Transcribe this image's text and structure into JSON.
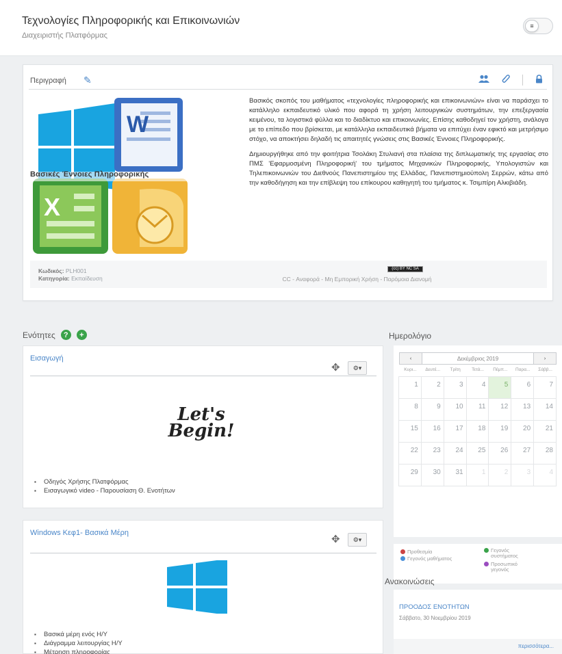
{
  "header": {
    "title": "Τεχνολογίες Πληροφορικής και Επικοινωνιών",
    "subtitle": "Διαχειριστής Πλατφόρμας"
  },
  "description": {
    "label": "Περιγραφή",
    "logo_caption": "Βασικές Έννοιες Πληροφορικής",
    "paragraphs": [
      "Βασικός σκοπός του μαθήματος «τεχνολογίες πληροφορικής και επικοινωνιών» είναι να παράσχει το κατάλληλο εκπαιδευτικό υλικό που αφορά τη χρήση λειτουργικών συστημάτων, την επεξεργασία κειμένου, τα λογιστικά φύλλα και το διαδίκτυο και επικοινωνίες. Επίσης καθοδηγεί τον χρήστη, ανάλογα με το επίπεδο που βρίσκεται, με κατάλληλα εκπαιδευτικά βήματα να επιτύχει έναν εφικτό και μετρήσιμο στόχο, να αποκτήσει δηλαδή τις απαιτητές γνώσεις στις Βασικές Έννοιες Πληροφορικής.",
      "Δημιουργήθηκε από την φοιτήτρια Τσολάκη Στυλιανή στα πλαίσια της διπλωματικής της εργασίας στο ΠΜΣ 'Εφαρμοσμένη Πληροφορική' του τμήματος Μηχανικών Πληροφορικής, Υπολογιστών και Τηλεπικοινωνιών του Διεθνούς Πανεπιστημίου της Ελλάδας, Πανεπιστημιούπολη Σερρών, κάτω από την καθοδήγηση και την επίβλεψη του επίκουρου καθηγητή του τμήματος κ. Τσιμπίρη Αλκιβιάδη."
    ],
    "code_label": "Κωδικός:",
    "code_value": "PLH001",
    "category_label": "Κατηγορία:",
    "category_value": "Εκπαίδευση",
    "license_badge": "(cc) BY NC SA",
    "license_text": "CC - Αναφορά - Μη Εμπορική Χρήση - Παρόμοια Διανομή"
  },
  "sections": {
    "title": "Ενότητες",
    "items": [
      {
        "title": "Εισαγωγή",
        "image_text_1": "Let's",
        "image_text_2": "Begin!",
        "links": [
          "Οδηγός Χρήσης Πλατφόρμας",
          "Εισαγωγικό video - Παρουσίαση Θ. Ενοτήτων"
        ]
      },
      {
        "title": "Windows Κεφ1- Βασικά Μέρη",
        "links": [
          "Βασικά μέρη ενός Η/Υ",
          "Διάγραμμα λειτουργίας Η/Υ",
          "Μέτρηση πληροφορίας"
        ]
      }
    ]
  },
  "calendar": {
    "title": "Ημερολόγιο",
    "month": "Δεκέμβριος 2019",
    "prev": "‹",
    "next": "›",
    "weekdays": [
      "Κυρι...",
      "Δευτέ...",
      "Τρίτη",
      "Τετά...",
      "Πέμπ...",
      "Παρα...",
      "Σάββ..."
    ],
    "today": 5,
    "days": [
      "1",
      "2",
      "3",
      "4",
      "5",
      "6",
      "7",
      "8",
      "9",
      "10",
      "11",
      "12",
      "13",
      "14",
      "15",
      "16",
      "17",
      "18",
      "19",
      "20",
      "21",
      "22",
      "23",
      "24",
      "25",
      "26",
      "27",
      "28",
      "29",
      "30",
      "31",
      "1",
      "2",
      "3",
      "4"
    ]
  },
  "legend": {
    "deadline": "Προθεσμία",
    "course_events": "Γεγονός μαθήματος",
    "system_events": "Γεγονός συστήματος",
    "personal_events": "Προσωπικό γεγονός",
    "colors": {
      "deadline": "#cc4444",
      "course": "#4a90d9",
      "system": "#3aa34a",
      "personal": "#9b4dc0"
    }
  },
  "announcements": {
    "title": "Ανακοινώσεις",
    "item_title": "ΠΡΟΟΔΟΣ ΕΝΟΤΗΤΩΝ",
    "item_date": "Σάββατο, 30 Νοεμβρίου 2019",
    "more": "περισσότερα..."
  }
}
